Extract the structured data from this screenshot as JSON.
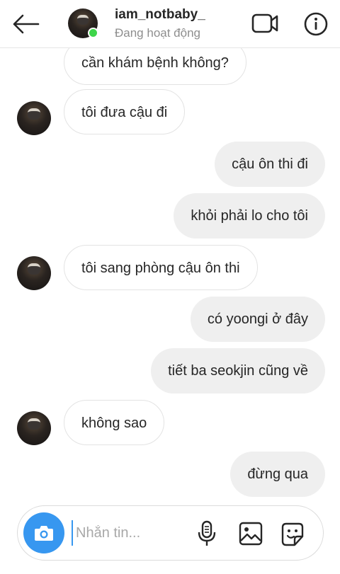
{
  "header": {
    "username": "iam_notbaby_",
    "status": "Đang hoạt động",
    "icons": {
      "back": "arrow-left-icon",
      "video": "video-call-icon",
      "info": "info-icon"
    }
  },
  "messages": [
    {
      "side": "in",
      "text": "cần khám bệnh không?",
      "avatar": false
    },
    {
      "side": "in",
      "text": "tôi đưa cậu đi",
      "avatar": true
    },
    {
      "side": "out",
      "text": "cậu ôn thi đi"
    },
    {
      "side": "out",
      "text": "khỏi phải lo cho tôi"
    },
    {
      "side": "in",
      "text": "tôi sang phòng cậu ôn thi",
      "avatar": true
    },
    {
      "side": "out",
      "text": "có yoongi ở đây"
    },
    {
      "side": "out",
      "text": "tiết ba seokjin cũng về"
    },
    {
      "side": "in",
      "text": "không sao",
      "avatar": true
    },
    {
      "side": "out",
      "text": "đừng qua"
    }
  ],
  "composer": {
    "placeholder": "Nhắn tin...",
    "value": "",
    "icons": {
      "camera": "camera-icon",
      "mic": "microphone-icon",
      "gallery": "image-gallery-icon",
      "sticker": "sticker-icon"
    }
  },
  "colors": {
    "accent": "#3797f0",
    "online": "#3ed54a",
    "outgoing_bubble": "#efefef",
    "incoming_border": "#e3e3e3"
  }
}
